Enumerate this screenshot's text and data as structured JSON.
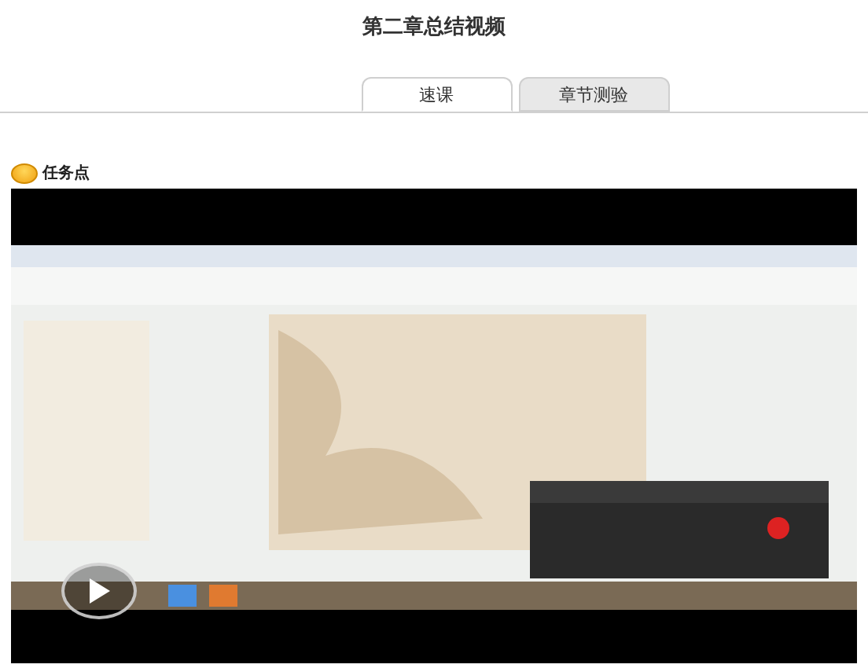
{
  "page_title": "第二章总结视频",
  "tabs": [
    {
      "label": "速课",
      "selected": true
    },
    {
      "label": "章节测验",
      "selected": false
    }
  ],
  "task_point": {
    "label": "任务点"
  }
}
